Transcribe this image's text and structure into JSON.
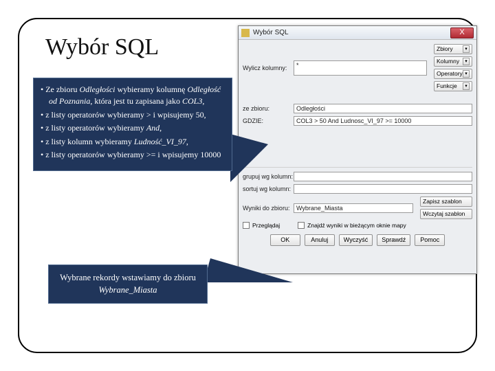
{
  "title": "Wybór SQL",
  "bullets": {
    "b1a": "Ze zbioru ",
    "b1i": "Odległości",
    "b1b": " wybieramy kolumnę ",
    "b1i2": "Odległość od Poznania",
    "b1c": ", która jest tu zapisana jako ",
    "b1i3": "COL3",
    "b1d": ",",
    "b2": "z listy operatorów wybieramy > i wpisujemy 50,",
    "b3a": "z listy operatorów wybieramy ",
    "b3i": "And",
    "b3b": ",",
    "b4a": "z listy kolumn wybieramy ",
    "b4i": "Ludność_VI_97",
    "b4b": ",",
    "b5": "z listy operatorów wybieramy >= i wpisujemy 10000"
  },
  "callout2a": "Wybrane rekordy wstawiamy do zbioru ",
  "callout2i": "Wybrane_Miasta",
  "dialog": {
    "title": "Wybór SQL",
    "close": "X",
    "labels": {
      "wylicz": "Wylicz kolumny:",
      "ze": "ze zbioru:",
      "gdzie": "GDZIE:",
      "grupuj": "grupuj wg kolumn:",
      "sortuj": "sortuj wg kolumn:",
      "wyniki": "Wyniki do zbioru:"
    },
    "fields": {
      "wylicz": "*",
      "ze": "Odległości",
      "gdzie": "COL3 > 50 And Ludnosc_VI_97 >= 10000",
      "wyniki": "Wybrane_Miasta"
    },
    "rbtns": {
      "zbiory": "Zbiory",
      "kolumny": "Kolumny",
      "operatory": "Operatory",
      "funkcje": "Funkcje",
      "zapisz": "Zapisz szablon",
      "wczytaj": "Wczytaj szablon"
    },
    "chk": {
      "przegl": "Przeglądaj",
      "znajdz": "Znajdź wyniki w bieżącym oknie mapy"
    },
    "btns": {
      "ok": "OK",
      "anuluj": "Anuluj",
      "wyczysc": "Wyczyść",
      "sprawdz": "Sprawdź",
      "pomoc": "Pomoc"
    }
  }
}
